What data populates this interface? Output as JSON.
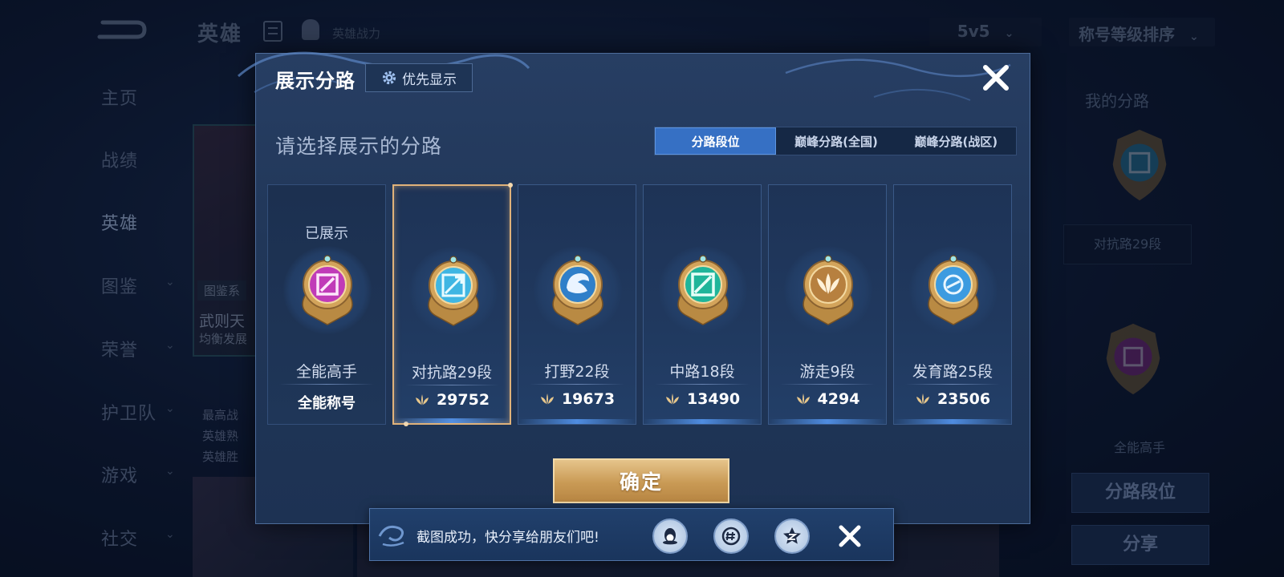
{
  "background": {
    "top_title": "英雄",
    "top_power_label": "英雄战力",
    "mode_dropdown": "5v5",
    "sort_dropdown": "称号等级排序",
    "nav": [
      {
        "label": "主页",
        "has_chevron": false
      },
      {
        "label": "战绩",
        "has_chevron": false
      },
      {
        "label": "英雄",
        "has_chevron": false,
        "active": true
      },
      {
        "label": "图鉴",
        "has_chevron": true
      },
      {
        "label": "荣誉",
        "has_chevron": true
      },
      {
        "label": "护卫队",
        "has_chevron": true
      },
      {
        "label": "游戏",
        "has_chevron": true
      },
      {
        "label": "社交",
        "has_chevron": true
      }
    ],
    "hero_card": {
      "tag": "图鉴系",
      "name": "武则天",
      "sub": "均衡发展"
    },
    "left_stats": [
      "最高战",
      "英雄熟",
      "英雄胜"
    ],
    "right_panel": {
      "title": "我的分路",
      "box_label": "对抗路29段",
      "label2": "全能高手",
      "button1": "分路段位",
      "button2": "分享"
    }
  },
  "modal": {
    "title": "展示分路",
    "priority_button": "优先显示",
    "subtitle": "请选择展示的分路",
    "tabs": [
      {
        "label": "分路段位",
        "active": true
      },
      {
        "label": "巅峰分路(全国)",
        "active": false
      },
      {
        "label": "巅峰分路(战区)",
        "active": false
      }
    ],
    "cards": [
      {
        "name": "全能高手",
        "shown_tag": "已展示",
        "title_label": "全能称号",
        "score": null,
        "badge": "allround-badge",
        "color": "#c03bb8",
        "selected": false
      },
      {
        "name": "对抗路29段",
        "score": "29752",
        "badge": "clash-lane-badge",
        "color": "#3fb6e3",
        "selected": true
      },
      {
        "name": "打野22段",
        "score": "19673",
        "badge": "jungle-badge",
        "color": "#2f7fc9",
        "selected": false
      },
      {
        "name": "中路18段",
        "score": "13490",
        "badge": "mid-lane-badge",
        "color": "#1fb59a",
        "selected": false
      },
      {
        "name": "游走9段",
        "score": "4294",
        "badge": "roam-badge",
        "color": "#b7803f",
        "selected": false
      },
      {
        "name": "发育路25段",
        "score": "23506",
        "badge": "farm-lane-badge",
        "color": "#3c9be0",
        "selected": false
      }
    ],
    "confirm_button": "确定"
  },
  "toast": {
    "text": "截图成功，快分享给朋友们吧!",
    "share_targets": [
      "qq-icon",
      "wechat-moments-icon",
      "qzone-icon"
    ]
  },
  "colors": {
    "accent_blue": "#3670c4",
    "gold": "#e0b27a",
    "modal_bg": "#213759"
  }
}
